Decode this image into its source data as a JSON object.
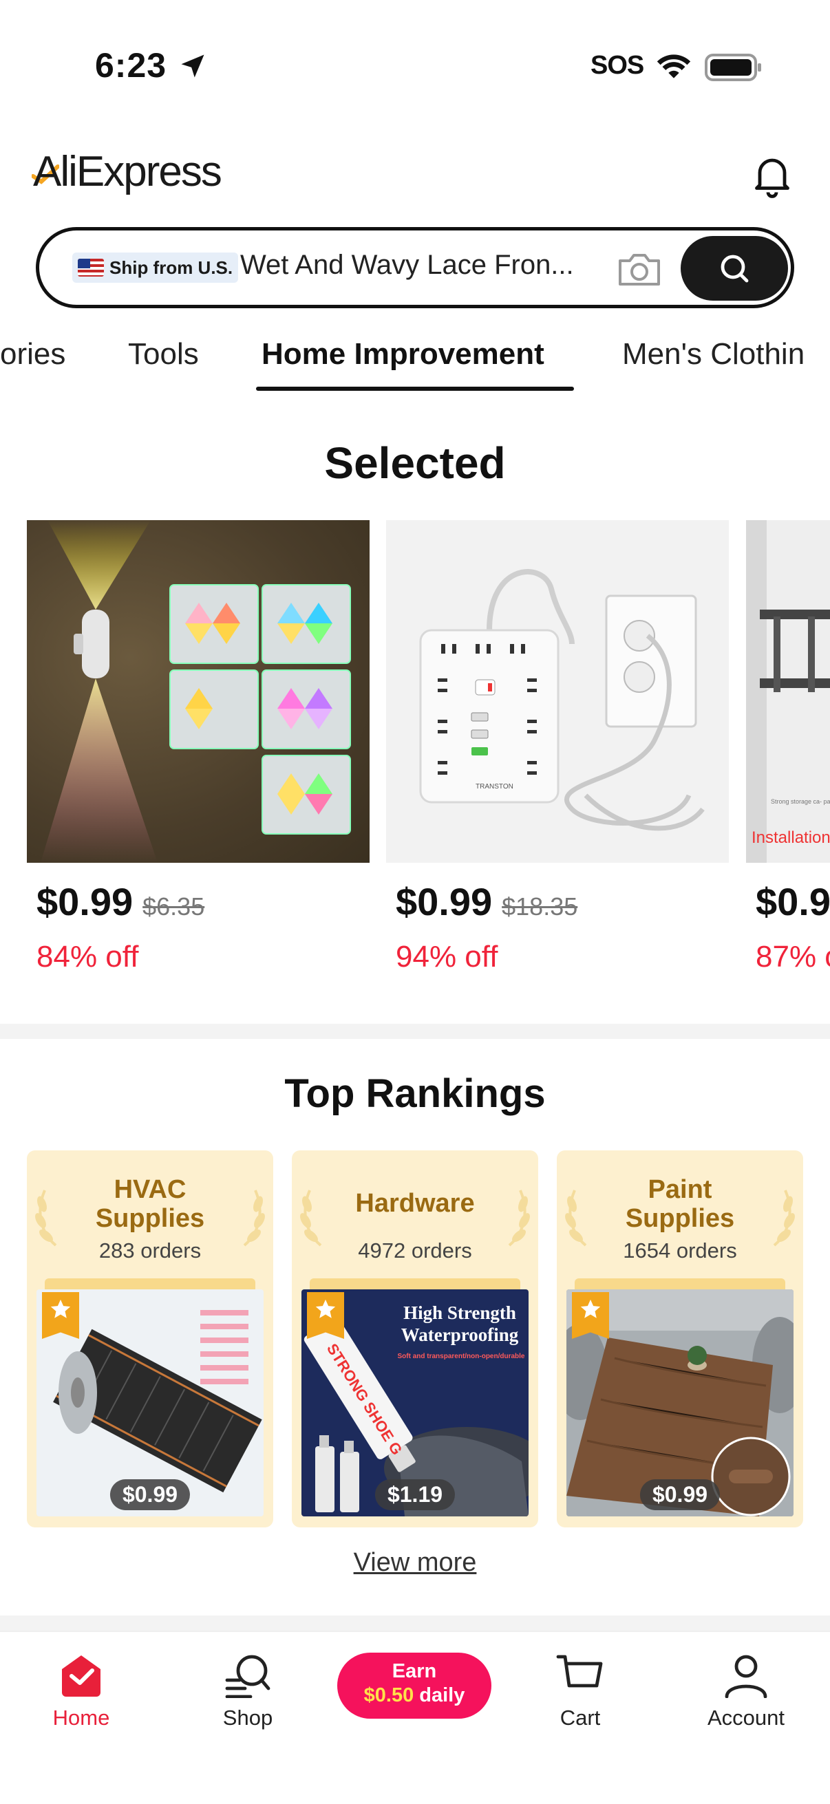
{
  "status_bar": {
    "time": "6:23",
    "sos": "SOS"
  },
  "header": {
    "logo": "AliExpress"
  },
  "search": {
    "badge": "Ship from U.S.",
    "query": "Wet And Wavy Lace Fron..."
  },
  "categories": [
    "ories",
    "Tools",
    "Home Improvement",
    "Men's Clothin"
  ],
  "selected": {
    "title": "Selected",
    "products": [
      {
        "price": "$0.99",
        "old_price": "$6.35",
        "discount": "84% off"
      },
      {
        "price": "$0.99",
        "old_price": "$18.35",
        "discount": "94% off",
        "brand_text": "TRANSTON"
      },
      {
        "price": "$0.9",
        "discount": "87% o",
        "overlay_text": "Installation",
        "caption": "Strong storage ca- pacity"
      }
    ]
  },
  "top_rankings": {
    "title": "Top Rankings",
    "cards": [
      {
        "name_line1": "HVAC",
        "name_line2": "Supplies",
        "orders": "283 orders",
        "price": "$0.99"
      },
      {
        "name_line1": "Hardware",
        "name_line2": "",
        "orders": "4972 orders",
        "price": "$1.19",
        "img_line1": "High Strength",
        "img_line2": "Waterproofing",
        "img_line3": "Soft and transparent/non-open/durable",
        "img_tube": "STRONG SHOE G"
      },
      {
        "name_line1": "Paint",
        "name_line2": "Supplies",
        "orders": "1654 orders",
        "price": "$0.99"
      }
    ],
    "view_more": "View more"
  },
  "bottom_nav": {
    "home": "Home",
    "shop": "Shop",
    "earn_top": "Earn",
    "earn_amount": "$0.50",
    "earn_suffix": " daily",
    "cart": "Cart",
    "account": "Account"
  },
  "colors": {
    "accent_red": "#f0233a",
    "earn_pink": "#f5125c",
    "ranking_bg": "#fdf0cf",
    "ranking_text": "#9a6a12"
  }
}
